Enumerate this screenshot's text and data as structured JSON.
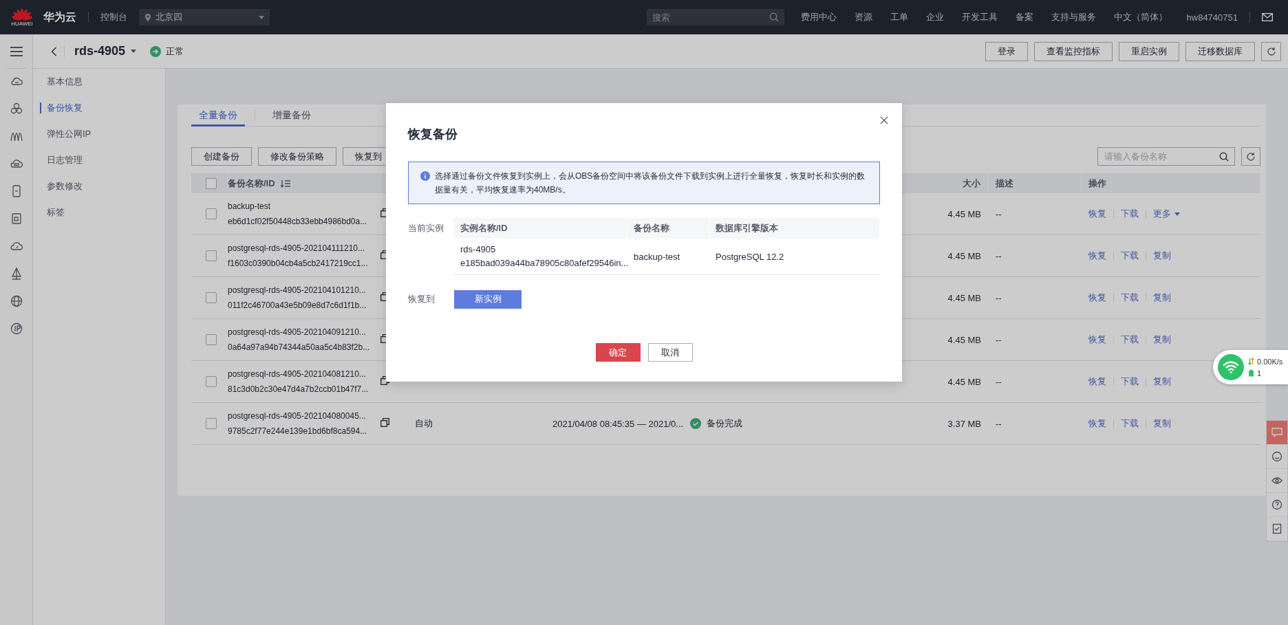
{
  "topbar": {
    "logo_caption": "HUAWEI",
    "brand": "华为云",
    "console": "控制台",
    "region": "北京四",
    "search": {
      "placeholder": "搜索"
    },
    "nav": [
      "费用中心",
      "资源",
      "工单",
      "企业",
      "开发工具",
      "备案",
      "支持与服务",
      "中文（简体）"
    ],
    "user": "hw84740751"
  },
  "instance": {
    "name": "rds-4905",
    "status": "正常",
    "actions": [
      "登录",
      "查看监控指标",
      "重启实例",
      "迁移数据库"
    ]
  },
  "sidebar": {
    "items": [
      {
        "label": "基本信息",
        "selected": false
      },
      {
        "label": "备份恢复",
        "selected": true
      },
      {
        "label": "弹性公网IP",
        "selected": false
      },
      {
        "label": "日志管理",
        "selected": false
      },
      {
        "label": "参数修改",
        "selected": false
      },
      {
        "label": "标签",
        "selected": false
      }
    ]
  },
  "tabs": [
    {
      "label": "全量备份",
      "selected": true
    },
    {
      "label": "增量备份",
      "selected": false
    }
  ],
  "toolbar": {
    "buttons": [
      "创建备份",
      "修改备份策略",
      "恢复到"
    ],
    "search": {
      "placeholder": "请输入备份名称"
    }
  },
  "table": {
    "select_all": false,
    "columns": {
      "name": "备份名称/ID",
      "size": "大小",
      "description": "描述",
      "actions": "操作"
    },
    "rows": [
      {
        "selected": false,
        "name": "backup-test",
        "id": "eb6d1cf02f50448cb33ebb4986bd0a...",
        "size": "4.45 MB",
        "description": "--",
        "actions": [
          {
            "label": "恢复",
            "kind": "link"
          },
          {
            "label": "下载",
            "kind": "link"
          },
          {
            "label": "更多",
            "kind": "menu"
          }
        ]
      },
      {
        "selected": false,
        "name": "postgresql-rds-4905-202104111210...",
        "id": "f1603c0390b04cb4a5cb2417219cc1...",
        "size": "4.45 MB",
        "description": "--",
        "actions": [
          {
            "label": "恢复",
            "kind": "link"
          },
          {
            "label": "下载",
            "kind": "link"
          },
          {
            "label": "复制",
            "kind": "link"
          }
        ]
      },
      {
        "selected": false,
        "name": "postgresql-rds-4905-202104101210...",
        "id": "011f2c46700a43e5b09e8d7c6d1f1b...",
        "size": "4.45 MB",
        "description": "--",
        "actions": [
          {
            "label": "恢复",
            "kind": "link"
          },
          {
            "label": "下载",
            "kind": "link"
          },
          {
            "label": "复制",
            "kind": "link"
          }
        ]
      },
      {
        "selected": false,
        "name": "postgresql-rds-4905-202104091210...",
        "id": "0a64a97a94b74344a50aa5c4b83f2b...",
        "size": "4.45 MB",
        "description": "--",
        "actions": [
          {
            "label": "恢复",
            "kind": "link"
          },
          {
            "label": "下载",
            "kind": "link"
          },
          {
            "label": "复制",
            "kind": "link"
          }
        ]
      },
      {
        "selected": false,
        "name": "postgresql-rds-4905-202104081210...",
        "id": "81c3d0b2c30e47d4a7b2ccb01b47f7...",
        "size": "4.45 MB",
        "description": "--",
        "actions": [
          {
            "label": "恢复",
            "kind": "link"
          },
          {
            "label": "下载",
            "kind": "link"
          },
          {
            "label": "复制",
            "kind": "link"
          }
        ]
      },
      {
        "selected": false,
        "name": "postgresql-rds-4905-202104080045...",
        "id": "9785c2f77e244e139e1bd6bf8ca594...",
        "type": "自动",
        "time": "2021/04/08 08:45:35 — 2021/0...",
        "status": "备份完成",
        "size": "3.37 MB",
        "description": "--",
        "actions": [
          {
            "label": "恢复",
            "kind": "link"
          },
          {
            "label": "下载",
            "kind": "link"
          },
          {
            "label": "复制",
            "kind": "link"
          }
        ]
      }
    ]
  },
  "modal": {
    "title": "恢复备份",
    "notice": "选择通过备份文件恢复到实例上，会从OBS备份空间中将该备份文件下载到实例上进行全量恢复，恢复时长和实例的数据量有关，平均恢复速率为40MB/s。",
    "current_label": "当前实例",
    "columns": [
      "实例名称/ID",
      "备份名称",
      "数据库引擎版本"
    ],
    "instance": {
      "name": "rds-4905",
      "id": "e185bad039a44ba78905c80afef29546in...",
      "backup": "backup-test",
      "engine": "PostgreSQL 12.2"
    },
    "restore_label": "恢复到",
    "targets": [
      {
        "label": "新实例",
        "selected": true
      }
    ],
    "buttons": [
      {
        "label": "确定",
        "kind": "primary"
      },
      {
        "label": "取消",
        "kind": "secondary"
      }
    ]
  },
  "net_widget": {
    "speed": "0.00K/s",
    "count": "1"
  }
}
